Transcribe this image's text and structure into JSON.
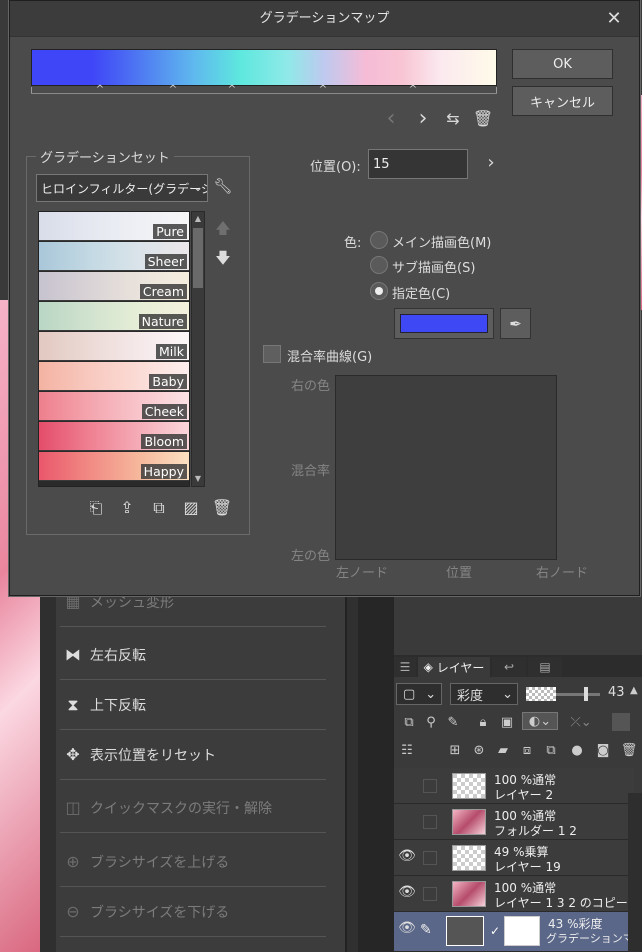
{
  "dialog": {
    "title": "グラデーションマップ",
    "ok_label": "OK",
    "cancel_label": "キャンセル",
    "gradient_set_group_label": "グラデーションセット",
    "gradient_set_selected": "ヒロインフィルター(グラデーションマ",
    "presets": [
      {
        "label": "Pure",
        "colors": [
          "#d9dde9",
          "#e5e8f0",
          "#eef0f5",
          "#f7f6f6"
        ]
      },
      {
        "label": "Sheer",
        "colors": [
          "#a9c7d9",
          "#c3d9e3",
          "#dbe4ea",
          "#ece7ea"
        ]
      },
      {
        "label": "Cream",
        "colors": [
          "#c7c3cf",
          "#d9d3d6",
          "#eae3dc",
          "#f6efdf"
        ]
      },
      {
        "label": "Nature",
        "colors": [
          "#b9d6c4",
          "#d1e3cf",
          "#e7eed7",
          "#f5f1dc"
        ]
      },
      {
        "label": "Milk",
        "colors": [
          "#e2c9c1",
          "#ecdad6",
          "#f5e9ea",
          "#fdf7f8"
        ]
      },
      {
        "label": "Baby",
        "colors": [
          "#f4b3a3",
          "#f8c9bf",
          "#fbdcd6",
          "#fdeeee"
        ]
      },
      {
        "label": "Cheek",
        "colors": [
          "#ee7f8d",
          "#f4a5ae",
          "#f8c6cc",
          "#fce3e6"
        ]
      },
      {
        "label": "Bloom",
        "colors": [
          "#e44d6a",
          "#ef8092",
          "#f5adb8",
          "#fbd7dc"
        ]
      },
      {
        "label": "Happy",
        "colors": [
          "#e9576b",
          "#f18a84",
          "#f6b99d",
          "#fbe1c3"
        ]
      }
    ],
    "position_label": "位置(O):",
    "position_value": "15",
    "color_label": "色:",
    "radio_main": "メイン描画色(M)",
    "radio_sub": "サブ描画色(S)",
    "radio_specified": "指定色(C)",
    "selected_radio": "specified",
    "specified_color": "#3e48f5",
    "blend_curve_label": "混合率曲線(G)",
    "curve_y_top": "右の色",
    "curve_y_mid": "混合率",
    "curve_y_bottom": "左の色",
    "curve_x_left": "左ノード",
    "curve_x_mid": "位置",
    "curve_x_right": "右ノード"
  },
  "menu": {
    "items": [
      {
        "label": "メッシュ変形",
        "icon": "mesh-transform-icon",
        "enabled": false
      },
      {
        "label": "左右反転",
        "icon": "flip-horizontal-icon",
        "enabled": true
      },
      {
        "label": "上下反転",
        "icon": "flip-vertical-icon",
        "enabled": true
      },
      {
        "label": "表示位置をリセット",
        "icon": "reset-view-icon",
        "enabled": true
      },
      {
        "label": "クイックマスクの実行・解除",
        "icon": "quick-mask-icon",
        "enabled": false
      },
      {
        "label": "ブラシサイズを上げる",
        "icon": "brush-size-up-icon",
        "enabled": false
      },
      {
        "label": "ブラシサイズを下げる",
        "icon": "brush-size-down-icon",
        "enabled": false
      }
    ]
  },
  "layers": {
    "tab_label": "レイヤー",
    "blend_mode": "彩度",
    "opacity": "43",
    "rows": [
      {
        "line1": "100 %通常",
        "line2": "レイヤー 2",
        "visible": false,
        "thumb": "transparent"
      },
      {
        "line1": "100 %通常",
        "line2": "フォルダー 1 2",
        "visible": false,
        "thumb": "picture"
      },
      {
        "line1": "49 %乗算",
        "line2": "レイヤー 19",
        "visible": true,
        "thumb": "transparent"
      },
      {
        "line1": "100 %通常",
        "line2": "レイヤー 1 3 2 のコピー",
        "visible": true,
        "thumb": "picture"
      },
      {
        "line1": "43 %彩度",
        "line2": "グラデーションマッ",
        "visible": true,
        "thumb": "gradient",
        "selected": true
      }
    ]
  }
}
